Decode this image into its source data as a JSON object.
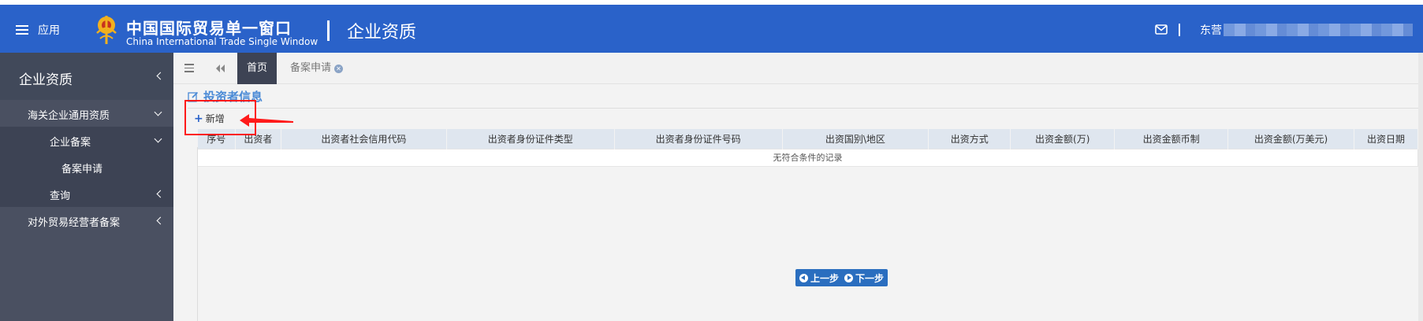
{
  "header": {
    "menu_label": "应用",
    "brand_cn": "中国国际贸易单一窗口",
    "brand_en": "China International Trade Single Window",
    "module_title": "企业资质",
    "user_name": "东营",
    "icons": {
      "menu": "hamburger-icon",
      "emblem": "customs-emblem-logo",
      "mail": "mail-icon"
    },
    "colors": {
      "bar": "#2a62c9"
    }
  },
  "sidebar": {
    "section_title": "企业资质",
    "items": [
      {
        "label": "海关企业通用资质",
        "state": "expanded"
      },
      {
        "label": "企业备案",
        "state": "expanded"
      },
      {
        "label": "备案申请",
        "state": "active"
      },
      {
        "label": "查询",
        "state": "collapsed"
      },
      {
        "label": "对外贸易经营者备案",
        "state": "collapsed"
      }
    ]
  },
  "tabs": {
    "items": [
      {
        "label": "首页",
        "active": true
      },
      {
        "label": "备案申请",
        "active": false,
        "closable": true
      }
    ]
  },
  "content": {
    "section_title": "投资者信息",
    "add_button": "新增",
    "table": {
      "columns": [
        "序号",
        "出资者",
        "出资者社会信用代码",
        "出资者身份证件类型",
        "出资者身份证件号码",
        "出资国别\\地区",
        "出资方式",
        "出资金额(万)",
        "出资金额币制",
        "出资金额(万美元)",
        "出资日期"
      ],
      "empty_text": "无符合条件的记录"
    },
    "prev_button": "上一步",
    "next_button": "下一步",
    "annotation_color": "#ff1a1a"
  }
}
